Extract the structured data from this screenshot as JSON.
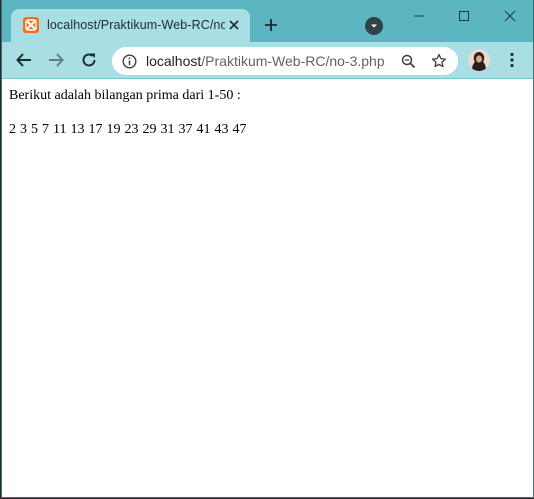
{
  "browser": {
    "tab": {
      "title": "localhost/Praktikum-Web-RC/no-3.php",
      "favicon": "xampp-icon",
      "close_icon": "close-icon"
    },
    "new_tab_icon": "plus-icon",
    "tab_search_icon": "chevron-down-icon",
    "window_controls": [
      "minimize-icon",
      "maximize-icon",
      "close-icon"
    ],
    "toolbar": {
      "back_icon": "arrow-left-icon",
      "forward_icon": "arrow-right-icon",
      "reload_icon": "reload-icon",
      "site_info_icon": "info-icon",
      "url_host": "localhost",
      "url_path": "/Praktikum-Web-RC/no-3.php",
      "zoom_icon": "zoom-icon",
      "bookmark_icon": "star-icon",
      "profile_icon": "avatar",
      "menu_icon": "kebab-menu-icon"
    },
    "colors": {
      "frame": "#5bb6c1",
      "active_tab": "#a7dfe5",
      "favicon": "#f36f1d"
    }
  },
  "content": {
    "heading": "Berikut adalah bilangan prima dari 1-50 :",
    "primes": [
      2,
      3,
      5,
      7,
      11,
      13,
      17,
      19,
      23,
      29,
      31,
      37,
      41,
      43,
      47
    ]
  }
}
